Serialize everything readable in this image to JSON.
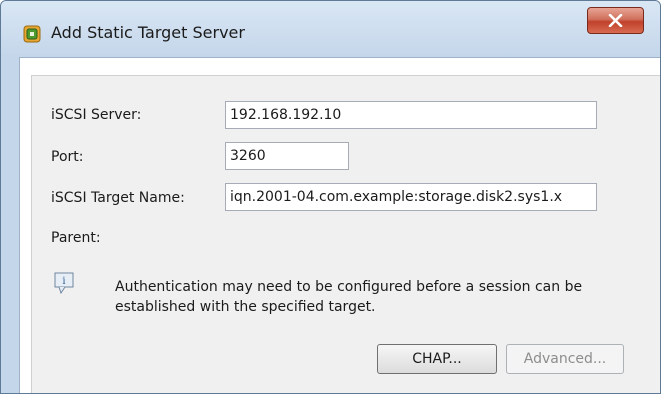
{
  "window": {
    "title": "Add Static Target Server",
    "app_icon": "vsphere-client-icon",
    "close_icon": "close-icon"
  },
  "form": {
    "iscsi_server": {
      "label": "iSCSI Server:",
      "value": "192.168.192.10"
    },
    "port": {
      "label": "Port:",
      "value": "3260"
    },
    "target_name": {
      "label": "iSCSI Target Name:",
      "value": "iqn.2001-04.com.example:storage.disk2.sys1.x"
    },
    "parent": {
      "label": "Parent:"
    }
  },
  "info": {
    "icon": "info-icon",
    "message": "Authentication may need to be configured before a session can be established with the specified target."
  },
  "buttons": {
    "chap": {
      "label": "CHAP...",
      "enabled": true
    },
    "advanced": {
      "label": "Advanced...",
      "enabled": false
    }
  },
  "colors": {
    "frame": "#c4d6ea",
    "close_button": "#c0412b",
    "panel": "#f0f0f0"
  }
}
